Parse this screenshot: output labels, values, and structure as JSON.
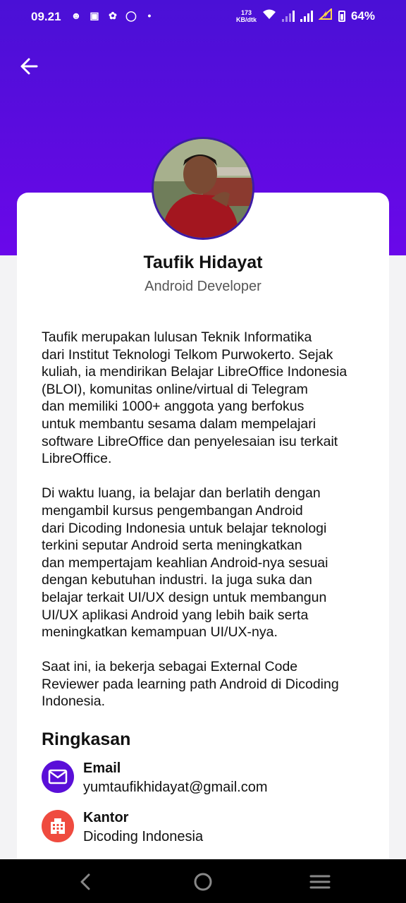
{
  "status_bar": {
    "time": "09.21",
    "net_speed_value": "173",
    "net_speed_unit": "KB/dtk",
    "battery": "64%"
  },
  "profile": {
    "name": "Taufik Hidayat",
    "role": "Android Developer",
    "bio": "Taufik merupakan lulusan Teknik Informatika\ndari Institut Teknologi Telkom Purwokerto. Sejak\nkuliah, ia mendirikan Belajar LibreOffice Indonesia\n(BLOI), komunitas online/virtual di Telegram\ndan memiliki 1000+ anggota yang berfokus\nuntuk membantu sesama dalam mempelajari\nsoftware LibreOffice dan penyelesaian isu terkait\nLibreOffice.\n\nDi waktu luang, ia belajar dan berlatih dengan\nmengambil kursus pengembangan Android\ndari Dicoding Indonesia untuk belajar teknologi\nterkini seputar Android serta meningkatkan\ndan mempertajam keahlian Android-nya sesuai\ndengan kebutuhan industri. Ia juga suka dan\nbelajar terkait UI/UX design untuk membangun\nUI/UX aplikasi Android yang lebih baik serta\nmeningkatkan kemampuan UI/UX-nya.\n\nSaat ini, ia bekerja sebagai External Code\nReviewer pada learning path Android di Dicoding\nIndonesia."
  },
  "summary": {
    "title": "Ringkasan",
    "items": [
      {
        "label": "Email",
        "value": "yumtaufikhidayat@gmail.com",
        "icon": "mail-icon",
        "color": "#5a0fd8"
      },
      {
        "label": "Kantor",
        "value": "Dicoding Indonesia",
        "icon": "building-icon",
        "color": "#ef4b3f"
      }
    ]
  },
  "colors": {
    "header": "#5e0be0",
    "accent": "#5a0fd8"
  }
}
